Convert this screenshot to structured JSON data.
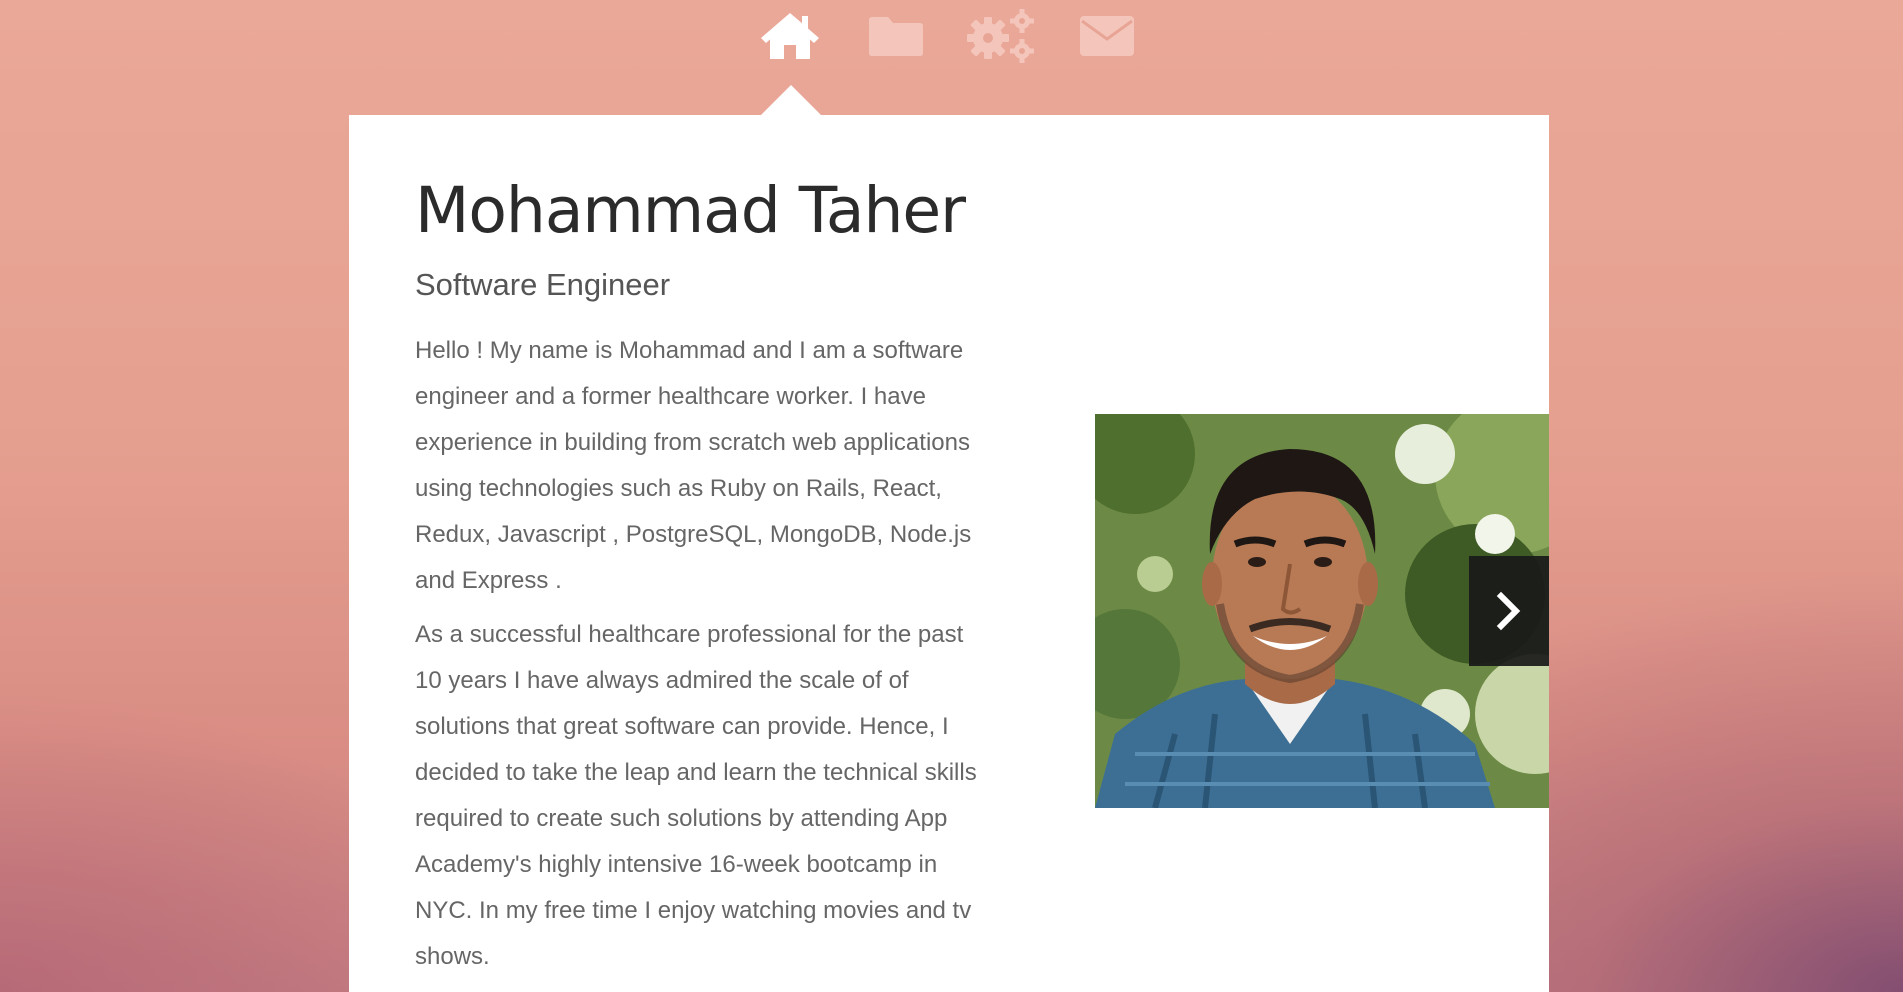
{
  "nav": {
    "items": [
      {
        "icon": "home-icon",
        "active": true
      },
      {
        "icon": "folder-icon",
        "active": false
      },
      {
        "icon": "gears-icon",
        "active": false
      },
      {
        "icon": "mail-icon",
        "active": false
      }
    ],
    "active_color": "#ffffff",
    "inactive_color": "#f4c6bb"
  },
  "profile": {
    "name": "Mohammad Taher",
    "title": "Software Engineer",
    "bio_paragraph_1": "Hello ! My name is Mohammad and I am a software engineer and a former healthcare worker. I have experience in building from scratch web applications using technologies such as Ruby on Rails, React, Redux, Javascript , PostgreSQL, MongoDB, Node.js and Express .",
    "bio_paragraph_2": "As a successful healthcare professional for the past 10 years I have always admired the scale of of solutions that great software can provide. Hence, I decided to take the leap and learn the technical skills required to create such solutions by attending App Academy's highly intensive 16-week bootcamp in NYC. In my free time I enjoy watching movies and tv shows."
  },
  "carousel": {
    "next_icon": "chevron-right-icon"
  },
  "colors": {
    "background_top": "#eaa898",
    "background_bottom_right": "#8a5a82",
    "card": "#ffffff",
    "heading": "#2b2b2b",
    "body_text": "#666666"
  }
}
